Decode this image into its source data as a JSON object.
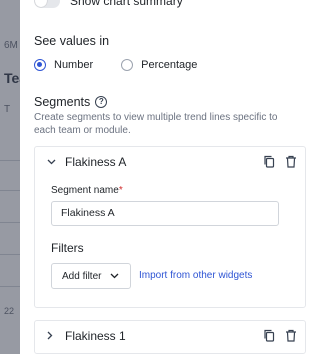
{
  "background": {
    "fragments": [
      "6M",
      "Tea",
      "T",
      "22"
    ]
  },
  "drawer": {
    "show_chart_summary": {
      "label": "Show chart summary",
      "enabled": false
    },
    "values": {
      "title": "See values in",
      "options": [
        {
          "label": "Number",
          "selected": true
        },
        {
          "label": "Percentage",
          "selected": false
        }
      ]
    },
    "segments": {
      "title": "Segments",
      "help_icon": "help-circle-icon",
      "description": "Create segments to view multiple trend lines specific to each team or module.",
      "items": [
        {
          "title": "Flakiness A",
          "expanded": true,
          "segment_name_label": "Segment name",
          "required_mark": "*",
          "segment_name_value": "Flakiness A",
          "filters_title": "Filters",
          "add_filter_label": "Add filter",
          "import_label": "Import from other widgets"
        },
        {
          "title": "Flakiness 1",
          "expanded": false
        }
      ]
    },
    "icons": {
      "copy": "copy-icon",
      "delete": "trash-icon",
      "expand": "chevron-down-icon",
      "collapsed": "chevron-right-icon"
    },
    "colors": {
      "accent": "#2f55d4",
      "required": "#d12b2b",
      "muted_text": "#6b7280"
    }
  }
}
